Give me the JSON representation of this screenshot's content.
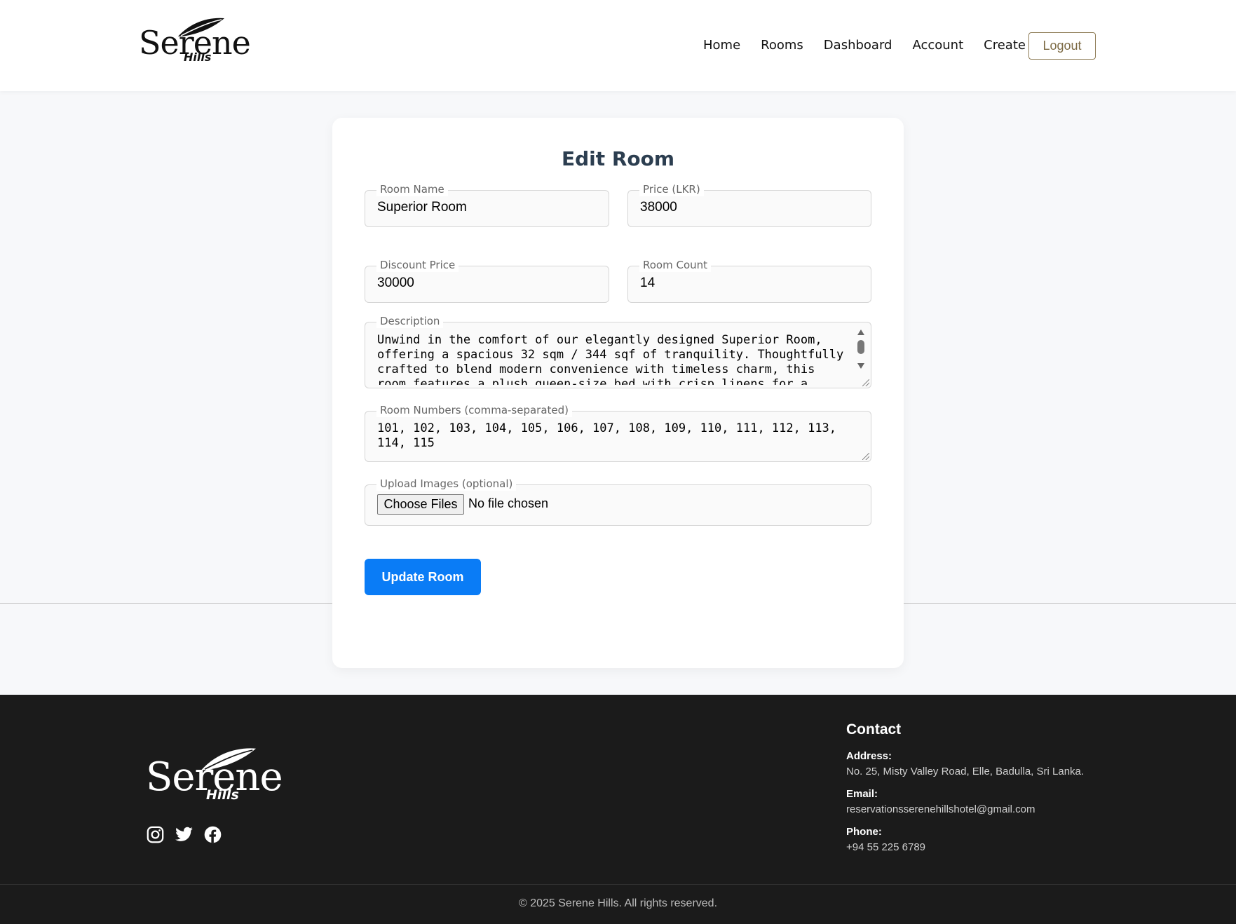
{
  "brand": {
    "name": "Serene",
    "sub": "Hills"
  },
  "nav": {
    "items": [
      "Home",
      "Rooms",
      "Dashboard",
      "Account",
      "Create"
    ],
    "logout_label": "Logout"
  },
  "form": {
    "title": "Edit Room",
    "room_name": {
      "label": "Room Name",
      "value": "Superior Room"
    },
    "price": {
      "label": "Price (LKR)",
      "value": "38000"
    },
    "discount_price": {
      "label": "Discount Price",
      "value": "30000"
    },
    "room_count": {
      "label": "Room Count",
      "value": "14"
    },
    "description": {
      "label": "Description",
      "value": "Unwind in the comfort of our elegantly designed Superior Room,\noffering a spacious 32 sqm / 344 sqf of tranquility. Thoughtfully\ncrafted to blend modern convenience with timeless charm, this\nroom features a plush queen-size bed with crisp linens for a"
    },
    "room_numbers": {
      "label": "Room Numbers (comma-separated)",
      "value": "101, 102, 103, 104, 105, 106, 107, 108, 109, 110, 111, 112, 113,\n114, 115"
    },
    "upload": {
      "label": "Upload Images (optional)",
      "button_label": "Choose Files",
      "status": "No file chosen"
    },
    "submit_label": "Update Room"
  },
  "footer": {
    "social_icons": [
      "instagram-icon",
      "twitter-icon",
      "facebook-icon"
    ],
    "contact_heading": "Contact",
    "address_label": "Address:",
    "address": "No. 25, Misty Valley Road, Elle, Badulla, Sri Lanka.",
    "email_label": "Email:",
    "email": "reservationsserenehillshotel@gmail.com",
    "phone_label": "Phone:",
    "phone": "+94 55 225 6789",
    "copyright": "© 2025 Serene Hills. All rights reserved."
  },
  "colors": {
    "accent": "#0a7cf6",
    "logout_border": "#8d7b55",
    "footer_bg": "#1b1b1b",
    "title": "#2c3e50"
  }
}
